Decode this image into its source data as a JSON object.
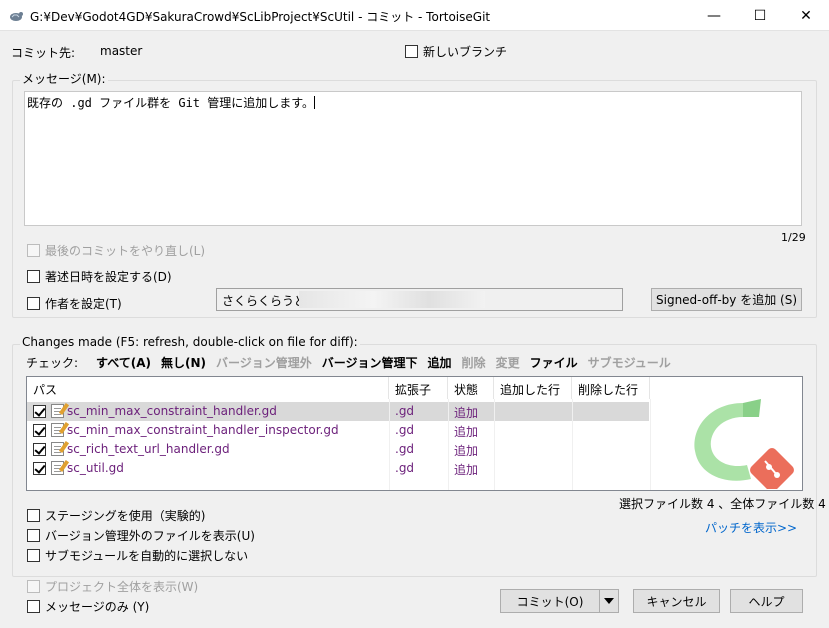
{
  "window": {
    "title": "G:¥Dev¥Godot4GD¥SakuraCrowd¥ScLibProject¥ScUtil - コミット - TortoiseGit",
    "minimize_glyph": "—",
    "maximize_glyph": "☐",
    "close_glyph": "✕"
  },
  "commit_target": {
    "label": "コミット先:",
    "branch": "master"
  },
  "new_branch": {
    "label": "新しいブランチ",
    "checked": false
  },
  "message": {
    "group_label": "メッセージ(M):",
    "text": "既存の .gd ファイル群を Git 管理に追加します。",
    "counter": "1/29"
  },
  "options": {
    "amend_label": "最後のコミットをやり直し(L)",
    "set_date_label": "著述日時を設定する(D)",
    "set_author_label": "作者を設定(T)",
    "author_value": "さくらくらうど",
    "signed_off_button": "Signed-off-by を追加 (S)"
  },
  "changes": {
    "group_label": "Changes made (F5: refresh, double-click on file for diff):",
    "check_label": "チェック:",
    "filters": [
      {
        "label": "すべて(A)",
        "enabled": true
      },
      {
        "label": "無し(N)",
        "enabled": true
      },
      {
        "label": "バージョン管理外",
        "enabled": false
      },
      {
        "label": "バージョン管理下",
        "enabled": true
      },
      {
        "label": "追加",
        "enabled": true
      },
      {
        "label": "削除",
        "enabled": false
      },
      {
        "label": "変更",
        "enabled": false
      },
      {
        "label": "ファイル",
        "enabled": true
      },
      {
        "label": "サブモジュール",
        "enabled": false
      }
    ],
    "columns": [
      "パス",
      "拡張子",
      "状態",
      "追加した行",
      "削除した行"
    ],
    "files": [
      {
        "path": "sc_min_max_constraint_handler.gd",
        "ext": ".gd",
        "status": "追加",
        "checked": true
      },
      {
        "path": "sc_min_max_constraint_handler_inspector.gd",
        "ext": ".gd",
        "status": "追加",
        "checked": true
      },
      {
        "path": "sc_rich_text_url_handler.gd",
        "ext": ".gd",
        "status": "追加",
        "checked": true
      },
      {
        "path": "sc_util.gd",
        "ext": ".gd",
        "status": "追加",
        "checked": true
      }
    ],
    "selection_summary": "選択ファイル数 4 、全体ファイル数 4",
    "show_patch_link": "パッチを表示>>",
    "staging_label": "ステージングを使用（実験的)",
    "show_unversioned_label": "バージョン管理外のファイルを表示(U)",
    "no_auto_submodule_label": "サブモジュールを自動的に選択しない"
  },
  "bottom": {
    "show_whole_project_label": "プロジェクト全体を表示(W)",
    "message_only_label": "メッセージのみ (Y)",
    "commit_button": "コミット(O)",
    "cancel_button": "キャンセル",
    "help_button": "ヘルプ"
  },
  "colors": {
    "accent": "#0066cc",
    "added_status": "#6b1f7a",
    "selected_row": "#d9d9d9"
  },
  "icons": [
    "tortoisegit-icon",
    "file-modified-icon",
    "tortoisegit-logo-icon",
    "dropdown-arrow-icon"
  ]
}
